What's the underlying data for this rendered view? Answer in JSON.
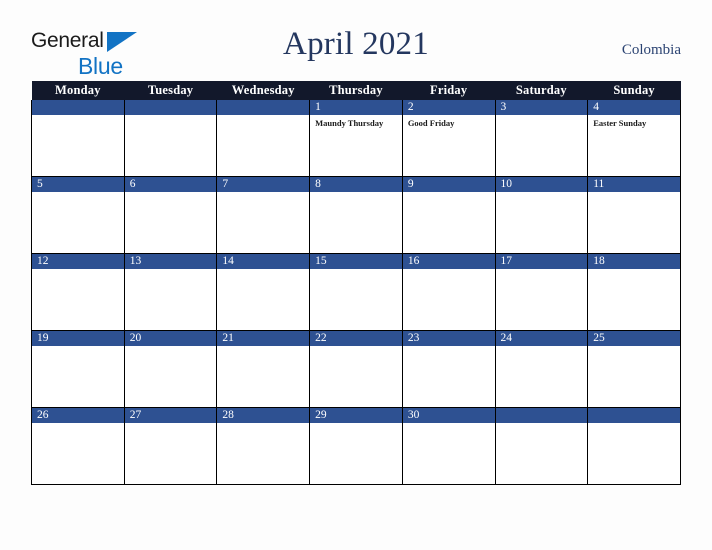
{
  "brand": {
    "word1": "General",
    "word2": "Blue",
    "triangle_color": "#1273c4",
    "word1_color": "#1b1b1b"
  },
  "header": {
    "title": "April 2021",
    "country": "Colombia",
    "title_color": "#24375f",
    "country_color": "#2b4372"
  },
  "calendar": {
    "weekday_headers": [
      "Monday",
      "Tuesday",
      "Wednesday",
      "Thursday",
      "Friday",
      "Saturday",
      "Sunday"
    ],
    "header_bg": "#12182b",
    "daybar_bg": "#2e5192",
    "weeks": [
      [
        {
          "date": "",
          "holidays": []
        },
        {
          "date": "",
          "holidays": []
        },
        {
          "date": "",
          "holidays": []
        },
        {
          "date": "1",
          "holidays": [
            "Maundy Thursday"
          ]
        },
        {
          "date": "2",
          "holidays": [
            "Good Friday"
          ]
        },
        {
          "date": "3",
          "holidays": []
        },
        {
          "date": "4",
          "holidays": [
            "Easter Sunday"
          ]
        }
      ],
      [
        {
          "date": "5",
          "holidays": []
        },
        {
          "date": "6",
          "holidays": []
        },
        {
          "date": "7",
          "holidays": []
        },
        {
          "date": "8",
          "holidays": []
        },
        {
          "date": "9",
          "holidays": []
        },
        {
          "date": "10",
          "holidays": []
        },
        {
          "date": "11",
          "holidays": []
        }
      ],
      [
        {
          "date": "12",
          "holidays": []
        },
        {
          "date": "13",
          "holidays": []
        },
        {
          "date": "14",
          "holidays": []
        },
        {
          "date": "15",
          "holidays": []
        },
        {
          "date": "16",
          "holidays": []
        },
        {
          "date": "17",
          "holidays": []
        },
        {
          "date": "18",
          "holidays": []
        }
      ],
      [
        {
          "date": "19",
          "holidays": []
        },
        {
          "date": "20",
          "holidays": []
        },
        {
          "date": "21",
          "holidays": []
        },
        {
          "date": "22",
          "holidays": []
        },
        {
          "date": "23",
          "holidays": []
        },
        {
          "date": "24",
          "holidays": []
        },
        {
          "date": "25",
          "holidays": []
        }
      ],
      [
        {
          "date": "26",
          "holidays": []
        },
        {
          "date": "27",
          "holidays": []
        },
        {
          "date": "28",
          "holidays": []
        },
        {
          "date": "29",
          "holidays": []
        },
        {
          "date": "30",
          "holidays": []
        },
        {
          "date": "",
          "holidays": []
        },
        {
          "date": "",
          "holidays": []
        }
      ]
    ]
  }
}
